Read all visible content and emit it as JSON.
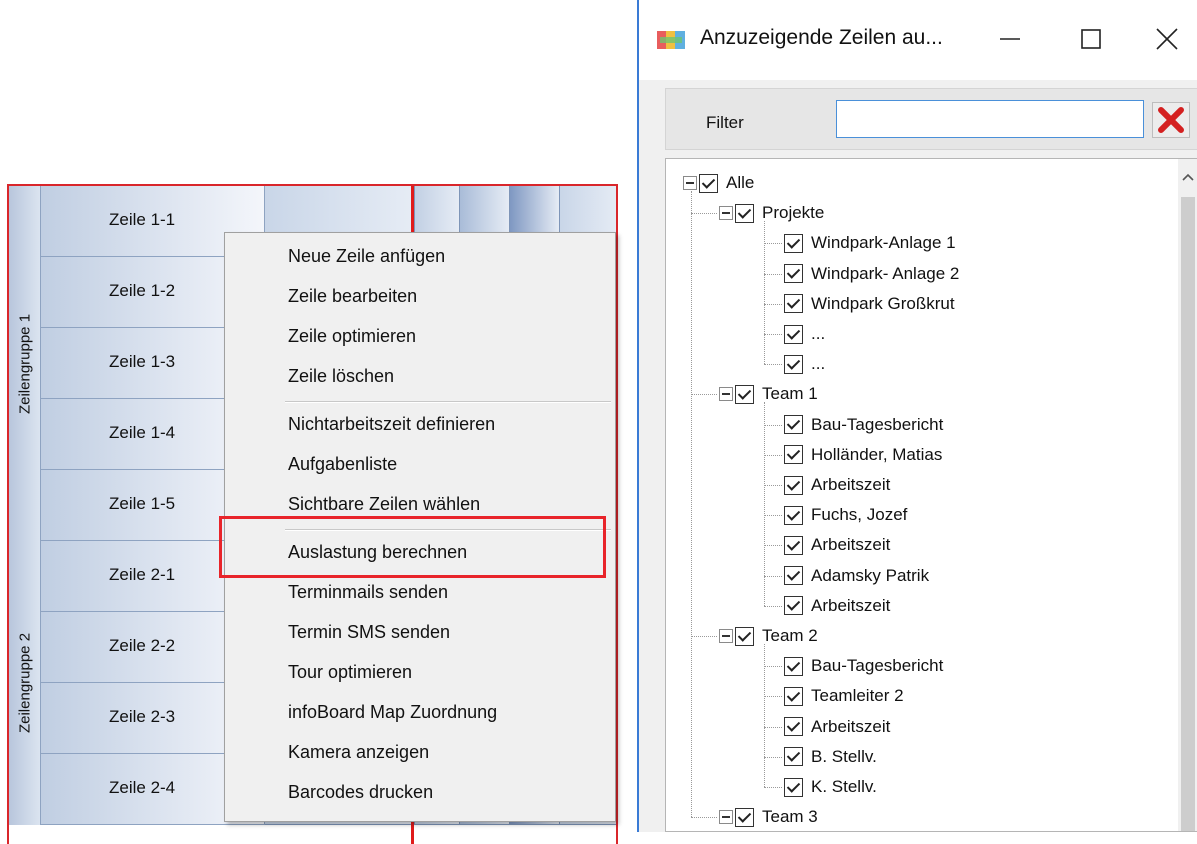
{
  "scheduler": {
    "groups": [
      {
        "label": "Zeilengruppe 1",
        "rows": [
          "Zeile 1-1",
          "Zeile 1-2",
          "Zeile 1-3",
          "Zeile 1-4",
          "Zeile 1-5"
        ]
      },
      {
        "label": "Zeilengruppe 2",
        "rows": [
          "Zeile 2-1",
          "Zeile 2-2",
          "Zeile 2-3",
          "Zeile 2-4"
        ]
      }
    ]
  },
  "context_menu": {
    "items": [
      {
        "label": "Neue Zeile anfügen"
      },
      {
        "label": "Zeile bearbeiten"
      },
      {
        "label": "Zeile optimieren"
      },
      {
        "label": "Zeile löschen"
      },
      {
        "label": "Nichtarbeitszeit definieren"
      },
      {
        "label": "Aufgabenliste"
      },
      {
        "label": "Sichtbare Zeilen wählen"
      },
      {
        "label": "Auslastung berechnen",
        "highlighted": true
      },
      {
        "label": "Terminmails senden"
      },
      {
        "label": "Termin SMS senden"
      },
      {
        "label": "Tour optimieren"
      },
      {
        "label": "infoBoard Map Zuordnung"
      },
      {
        "label": "Kamera anzeigen"
      },
      {
        "label": "Barcodes drucken"
      }
    ]
  },
  "dialog": {
    "title": "Anzuzeigende Zeilen au...",
    "icons": {
      "app": "app-logo-icon",
      "minimize": "minimize-icon",
      "maximize": "maximize-icon",
      "close": "close-icon",
      "clear": "red-x-clear-icon"
    },
    "filter": {
      "label": "Filter",
      "value": "",
      "placeholder": ""
    },
    "tree": {
      "root": {
        "label": "Alle",
        "checked": true,
        "expanded": true
      },
      "nodes": [
        {
          "label": "Projekte",
          "checked": true,
          "expanded": true,
          "children": [
            "Windpark-Anlage 1",
            "Windpark- Anlage 2",
            "Windpark Großkrut",
            "...",
            "..."
          ]
        },
        {
          "label": "Team 1",
          "checked": true,
          "expanded": true,
          "children": [
            "Bau-Tagesbericht",
            "Holländer, Matias",
            "Arbeitszeit",
            "Fuchs, Jozef",
            "Arbeitszeit",
            "Adamsky Patrik",
            "Arbeitszeit"
          ]
        },
        {
          "label": "Team 2",
          "checked": true,
          "expanded": true,
          "children": [
            "Bau-Tagesbericht",
            "Teamleiter 2",
            "Arbeitszeit",
            "B. Stellv.",
            "K. Stellv."
          ]
        },
        {
          "label": "Team 3",
          "checked": true,
          "expanded": true,
          "children": []
        }
      ]
    }
  },
  "colors": {
    "accent_red": "#e8242a",
    "dialog_border": "#3a7bd5",
    "filter_border": "#4a90d9"
  }
}
